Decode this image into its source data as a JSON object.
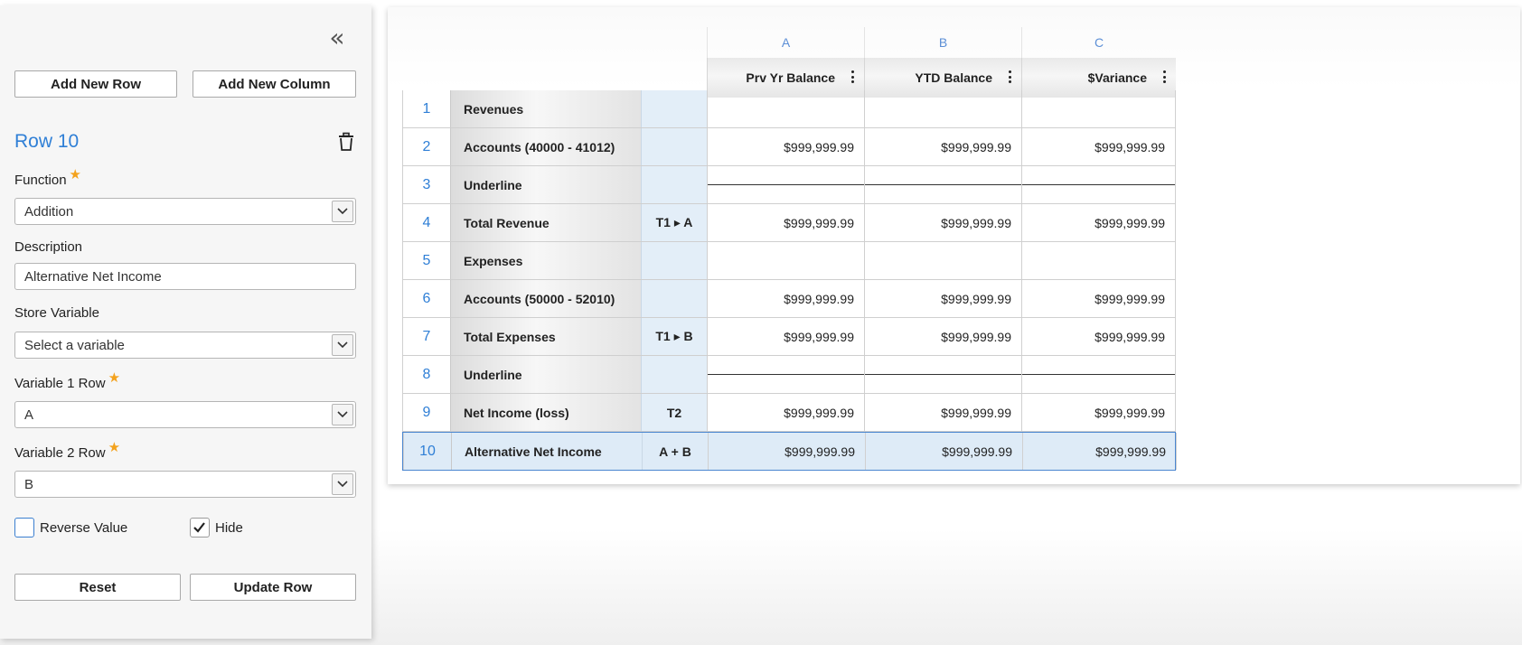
{
  "panel": {
    "collapse_glyph": "«",
    "add_row_label": "Add New Row",
    "add_column_label": "Add New Column",
    "row_title": "Row 10",
    "function_label": "Function",
    "function_value": "Addition",
    "description_label": "Description",
    "description_value": "Alternative Net Income",
    "store_variable_label": "Store Variable",
    "store_variable_placeholder": "Select a variable",
    "variable1_label": "Variable 1 Row",
    "variable1_value": "A",
    "variable2_label": "Variable 2 Row",
    "variable2_value": "B",
    "reverse_value_label": "Reverse Value",
    "reverse_value_checked": false,
    "hide_label": "Hide",
    "hide_checked": true,
    "reset_label": "Reset",
    "update_label": "Update Row",
    "required_star": "★"
  },
  "grid": {
    "columns": [
      {
        "letter": "A",
        "title": "Prv Yr Balance"
      },
      {
        "letter": "B",
        "title": "YTD Balance"
      },
      {
        "letter": "C",
        "title": "$Variance"
      }
    ],
    "rows": [
      {
        "num": "1",
        "desc": "Revenues",
        "var": "",
        "a": "",
        "b": "",
        "c": "",
        "underline": false
      },
      {
        "num": "2",
        "desc": "Accounts (40000 - 41012)",
        "var": "",
        "a": "$999,999.99",
        "b": "$999,999.99",
        "c": "$999,999.99",
        "underline": false
      },
      {
        "num": "3",
        "desc": "Underline",
        "var": "",
        "a": "",
        "b": "",
        "c": "",
        "underline": true
      },
      {
        "num": "4",
        "desc": "Total Revenue",
        "var": "T1 ▸ A",
        "a": "$999,999.99",
        "b": "$999,999.99",
        "c": "$999,999.99",
        "underline": false
      },
      {
        "num": "5",
        "desc": "Expenses",
        "var": "",
        "a": "",
        "b": "",
        "c": "",
        "underline": false
      },
      {
        "num": "6",
        "desc": "Accounts (50000 - 52010)",
        "var": "",
        "a": "$999,999.99",
        "b": "$999,999.99",
        "c": "$999,999.99",
        "underline": false
      },
      {
        "num": "7",
        "desc": "Total Expenses",
        "var": "T1 ▸ B",
        "a": "$999,999.99",
        "b": "$999,999.99",
        "c": "$999,999.99",
        "underline": false
      },
      {
        "num": "8",
        "desc": "Underline",
        "var": "",
        "a": "",
        "b": "",
        "c": "",
        "underline": true
      },
      {
        "num": "9",
        "desc": "Net Income (loss)",
        "var": "T2",
        "a": "$999,999.99",
        "b": "$999,999.99",
        "c": "$999,999.99",
        "underline": false
      },
      {
        "num": "10",
        "desc": "Alternative Net Income",
        "var": "A + B",
        "a": "$999,999.99",
        "b": "$999,999.99",
        "c": "$999,999.99",
        "underline": false,
        "selected": true
      }
    ]
  },
  "colors": {
    "accent": "#2f7fd6",
    "required_star": "#f3a21d",
    "selected_row": "#deebf7"
  }
}
